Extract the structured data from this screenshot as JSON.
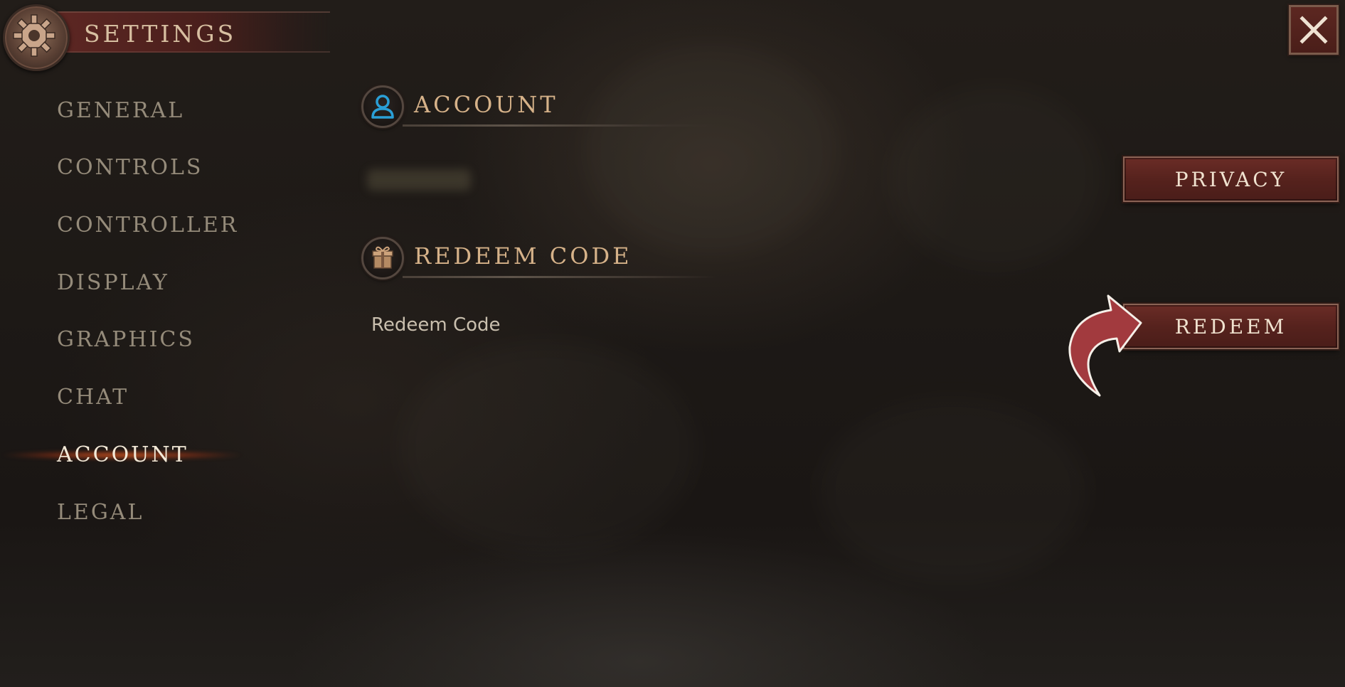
{
  "header": {
    "title": "SETTINGS",
    "icon": "gear-icon",
    "close_icon": "close-icon"
  },
  "sidebar": {
    "items": [
      {
        "label": "GENERAL",
        "active": false
      },
      {
        "label": "CONTROLS",
        "active": false
      },
      {
        "label": "CONTROLLER",
        "active": false
      },
      {
        "label": "DISPLAY",
        "active": false
      },
      {
        "label": "GRAPHICS",
        "active": false
      },
      {
        "label": "CHAT",
        "active": false
      },
      {
        "label": "ACCOUNT",
        "active": true
      },
      {
        "label": "LEGAL",
        "active": false
      }
    ]
  },
  "main": {
    "account_section": {
      "title": "ACCOUNT",
      "icon": "user-icon",
      "privacy_button": "PRIVACY"
    },
    "redeem_section": {
      "title": "REDEEM CODE",
      "icon": "gift-icon",
      "row_label": "Redeem Code",
      "redeem_button": "REDEEM"
    }
  },
  "colors": {
    "accent_red": "#5c2721",
    "gold_text": "#d6b289",
    "nav_inactive": "#958b7a",
    "nav_active": "#f3e9d7",
    "active_glow": "#ff6e28",
    "annotation_arrow": "#a23a3e",
    "user_icon_blue": "#2a9fd6"
  }
}
